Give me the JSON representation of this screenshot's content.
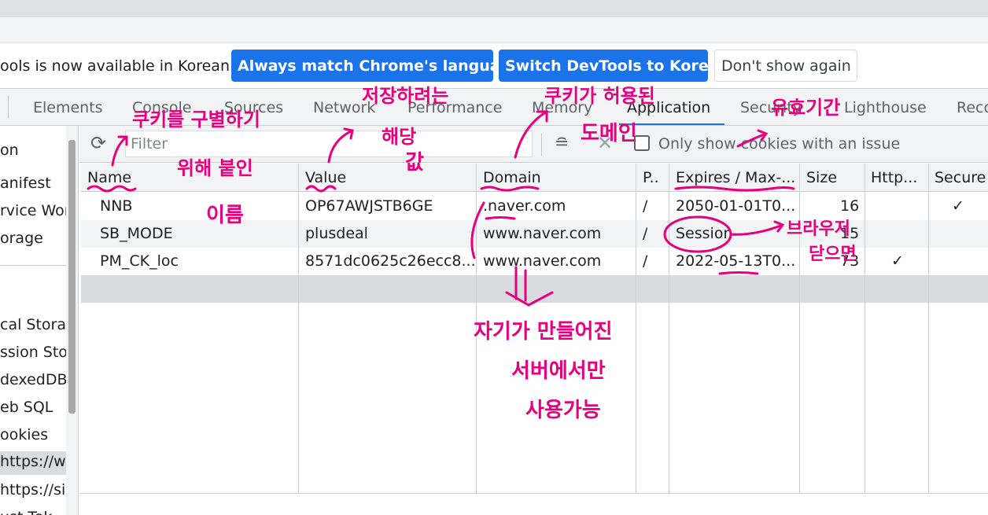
{
  "infobar": {
    "message": "ools is now available in Korean!",
    "btn_always": "Always match Chrome's language",
    "btn_switch": "Switch DevTools to Korean",
    "btn_dont": "Don't show again"
  },
  "tabs": [
    "Elements",
    "Console",
    "Sources",
    "Network",
    "Performance",
    "Memory",
    "Application",
    "Security",
    "Lighthouse",
    "Reco"
  ],
  "active_tab": "Application",
  "sidebar": {
    "items": [
      "on",
      "anifest",
      "rvice Wor",
      "orage",
      "cal Storag",
      "ssion Sto",
      "dexedDB",
      "eb SQL",
      "ookies",
      "https://w",
      "https://si",
      "ust Tok"
    ]
  },
  "toolbar": {
    "filter_placeholder": "Filter",
    "only_issue_label": "Only show cookies with an issue"
  },
  "table": {
    "headers": [
      "Name",
      "Value",
      "Domain",
      "P..",
      "Expires / Max-...",
      "Size",
      "Http...",
      "Secure"
    ],
    "rows": [
      {
        "name": "NNB",
        "value": "OP67AWJSTB6GE",
        "domain": ".naver.com",
        "path": "/",
        "expires": "2050-01-01T0...",
        "size": "16",
        "http": "",
        "secure": "✓"
      },
      {
        "name": "SB_MODE",
        "value": "plusdeal",
        "domain": "www.naver.com",
        "path": "/",
        "expires": "Session",
        "size": "15",
        "http": "",
        "secure": ""
      },
      {
        "name": "PM_CK_loc",
        "value": "8571dc0625c26ecc8...",
        "domain": "www.naver.com",
        "path": "/",
        "expires": "2022-05-13T0...",
        "size": "73",
        "http": "✓",
        "secure": ""
      }
    ]
  },
  "annotations": {
    "color": "#e6007e",
    "name_note": "쿠키를 구별하기",
    "name_note2": "위해 붙인",
    "name_note3": "이름",
    "value_note": "저장하려는",
    "value_note2": "해당",
    "value_note3": "값",
    "domain_note": "쿠키가 허용된",
    "domain_note2": "도메인",
    "domain_note4": "자기가 만들어진",
    "domain_note5": "서버에서만",
    "domain_note6": "사용가능",
    "expires_note": "유효기간",
    "session_note": "브라우저",
    "session_note2": "닫으면"
  }
}
